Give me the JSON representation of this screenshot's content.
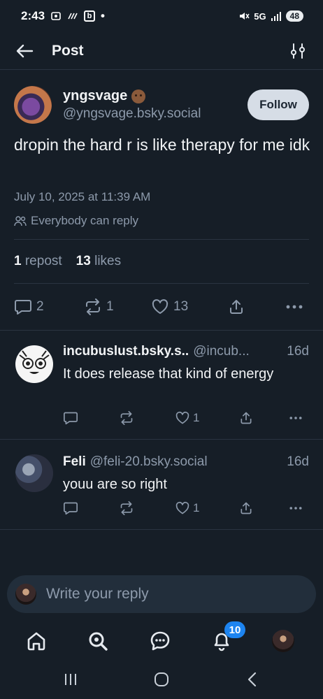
{
  "status_bar": {
    "time": "2:43",
    "network": "5G",
    "battery": "48"
  },
  "header": {
    "title": "Post"
  },
  "post": {
    "author_display": "yngsvage",
    "author_handle": "@yngsvage.bsky.social",
    "follow_label": "Follow",
    "text": "dropin the hard r is like therapy for me idk",
    "timestamp": "July 10, 2025 at 11:39 AM",
    "reply_setting": "Everybody can reply",
    "reposts_count": "1",
    "reposts_label": "repost",
    "likes_count": "13",
    "likes_label": "likes",
    "actions": {
      "replies": "2",
      "reposts": "1",
      "likes": "13"
    }
  },
  "replies": [
    {
      "name": "incubuslust.bsky.s..",
      "handle": "@incub...",
      "age": "16d",
      "text": "It does release that kind of energy",
      "likes": "1"
    },
    {
      "name": "Feli",
      "handle": "@feli-20.bsky.social",
      "age": "16d",
      "text": "youu are so right",
      "likes": "1"
    }
  ],
  "composer": {
    "placeholder": "Write your reply"
  },
  "tabbar": {
    "notifications_badge": "10"
  }
}
